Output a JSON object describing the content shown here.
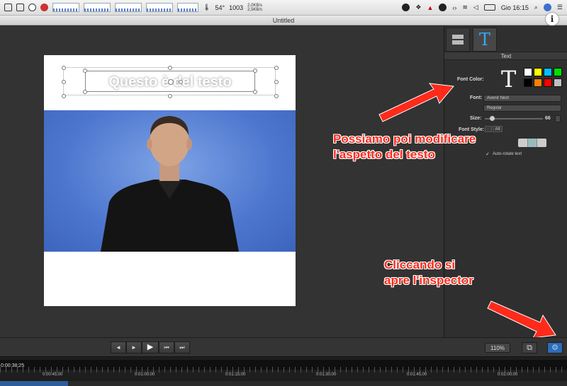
{
  "menubar": {
    "cpu_temp": "54°",
    "fan": "1003",
    "net_up": "2,0KB/s",
    "net_down": "2,5KB/s",
    "clock": "Gio 16:15"
  },
  "window": {
    "title": "Untitled",
    "info_glyph": "i"
  },
  "canvas": {
    "slide_text": "Questo è del testo"
  },
  "inspector": {
    "tab_text_glyph": "T",
    "header_title": "Text",
    "font_color_label": "Font Color:",
    "big_t": "T",
    "swatch_colors": [
      "#ffffff",
      "#ffff00",
      "#00c0ff",
      "#00e000",
      "#000000",
      "#ff8000",
      "#ff0000",
      "#c0c0c0"
    ],
    "font_label": "Font:",
    "font_value": "Avenir Next",
    "style_value": "Regular",
    "size_label": "Size:",
    "size_value": "66",
    "font_style_label": "Font Style:",
    "alt_label": "Alt",
    "autorotate_label": "Auto-rotate text"
  },
  "annotations": {
    "modify_line1": "Possiamo poi modificare",
    "modify_line2": "l'aspetto del testo",
    "inspector_line1": "Cliccando si",
    "inspector_line2": "apre l'inspector"
  },
  "controls": {
    "prev": "◄",
    "next": "►",
    "play": "▶",
    "skip_back": "⏮",
    "skip_fwd": "⏭",
    "zoom": "110%",
    "crop_icon": "⧉",
    "gear_icon": "⚙"
  },
  "timeline": {
    "current_time": "0:00:38;25",
    "labels": [
      "0:00:45;00",
      "0:01:00;00",
      "0:01:15;00",
      "0:01:30;00",
      "0:01:45;00",
      "0:02:00;00"
    ]
  }
}
